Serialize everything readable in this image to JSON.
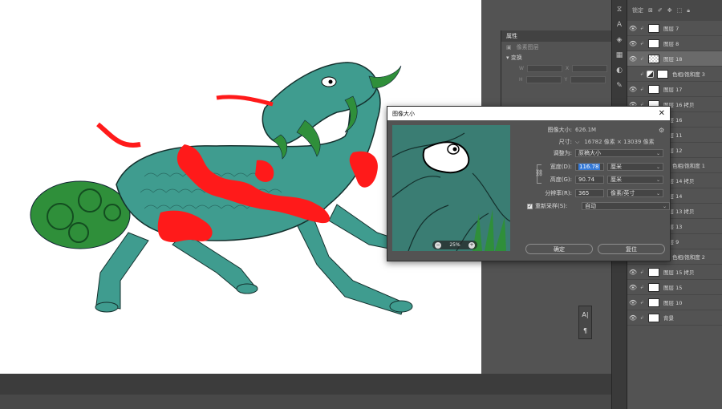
{
  "props": {
    "title": "属性",
    "subtitle": "像素图层",
    "section": "变换",
    "w_label": "W",
    "h_label": "H",
    "x_label": "X",
    "y_label": "Y"
  },
  "layers": [
    {
      "name": "图层 7",
      "visible": true,
      "thumb": "white"
    },
    {
      "name": "图层 8",
      "visible": true,
      "thumb": "white"
    },
    {
      "name": "图层 18",
      "visible": true,
      "thumb": "check",
      "selected": true
    },
    {
      "name": "色相/饱和度 3",
      "visible": false,
      "thumb": "adj"
    },
    {
      "name": "图层 17",
      "visible": true,
      "thumb": "white"
    },
    {
      "name": "图层 16 拷贝",
      "visible": true,
      "thumb": "white"
    },
    {
      "name": "图层 16",
      "visible": true,
      "thumb": "white"
    },
    {
      "name": "图层 11",
      "visible": true,
      "thumb": "white"
    },
    {
      "name": "图层 12",
      "visible": true,
      "thumb": "white"
    },
    {
      "name": "色相/饱和度 1",
      "visible": true,
      "thumb": "adj"
    },
    {
      "name": "图层 14 拷贝",
      "visible": true,
      "thumb": "white"
    },
    {
      "name": "图层 14",
      "visible": true,
      "thumb": "white"
    },
    {
      "name": "图层 13 拷贝",
      "visible": true,
      "thumb": "white"
    },
    {
      "name": "图层 13",
      "visible": true,
      "thumb": "white"
    },
    {
      "name": "图层 9",
      "visible": true,
      "thumb": "white"
    },
    {
      "name": "色相/饱和度 2",
      "visible": true,
      "thumb": "adj"
    },
    {
      "name": "图层 15 拷贝",
      "visible": true,
      "thumb": "white"
    },
    {
      "name": "图层 15",
      "visible": true,
      "thumb": "white"
    },
    {
      "name": "图层 10",
      "visible": true,
      "thumb": "white"
    },
    {
      "name": "背景",
      "visible": true,
      "thumb": "white"
    }
  ],
  "layers_toolbar": {
    "lock_label": "锁定"
  },
  "dialog": {
    "title": "图像大小",
    "image_size_label": "图像大小:",
    "image_size_value": "626.1M",
    "dimensions_label": "尺寸:",
    "dimensions_value": "16782 像素  ×  13039 像素",
    "fit_label": "调整为:",
    "fit_value": "原稿大小",
    "width_label": "宽度(D):",
    "width_value": "116.78",
    "width_unit": "厘米",
    "height_label": "高度(G):",
    "height_value": "90.74",
    "height_unit": "厘米",
    "resolution_label": "分辨率(R):",
    "resolution_value": "365",
    "resolution_unit": "像素/英寸",
    "resample_label": "重新采样(S):",
    "resample_value": "自动",
    "resample_checked": true,
    "zoom_value": "25%",
    "ok_label": "确定",
    "reset_label": "复位"
  },
  "colors": {
    "qilin_body": "#3f9c8f",
    "qilin_dark": "#1f5550",
    "flame": "#ff1a1a",
    "hair": "#2f8f3a"
  }
}
